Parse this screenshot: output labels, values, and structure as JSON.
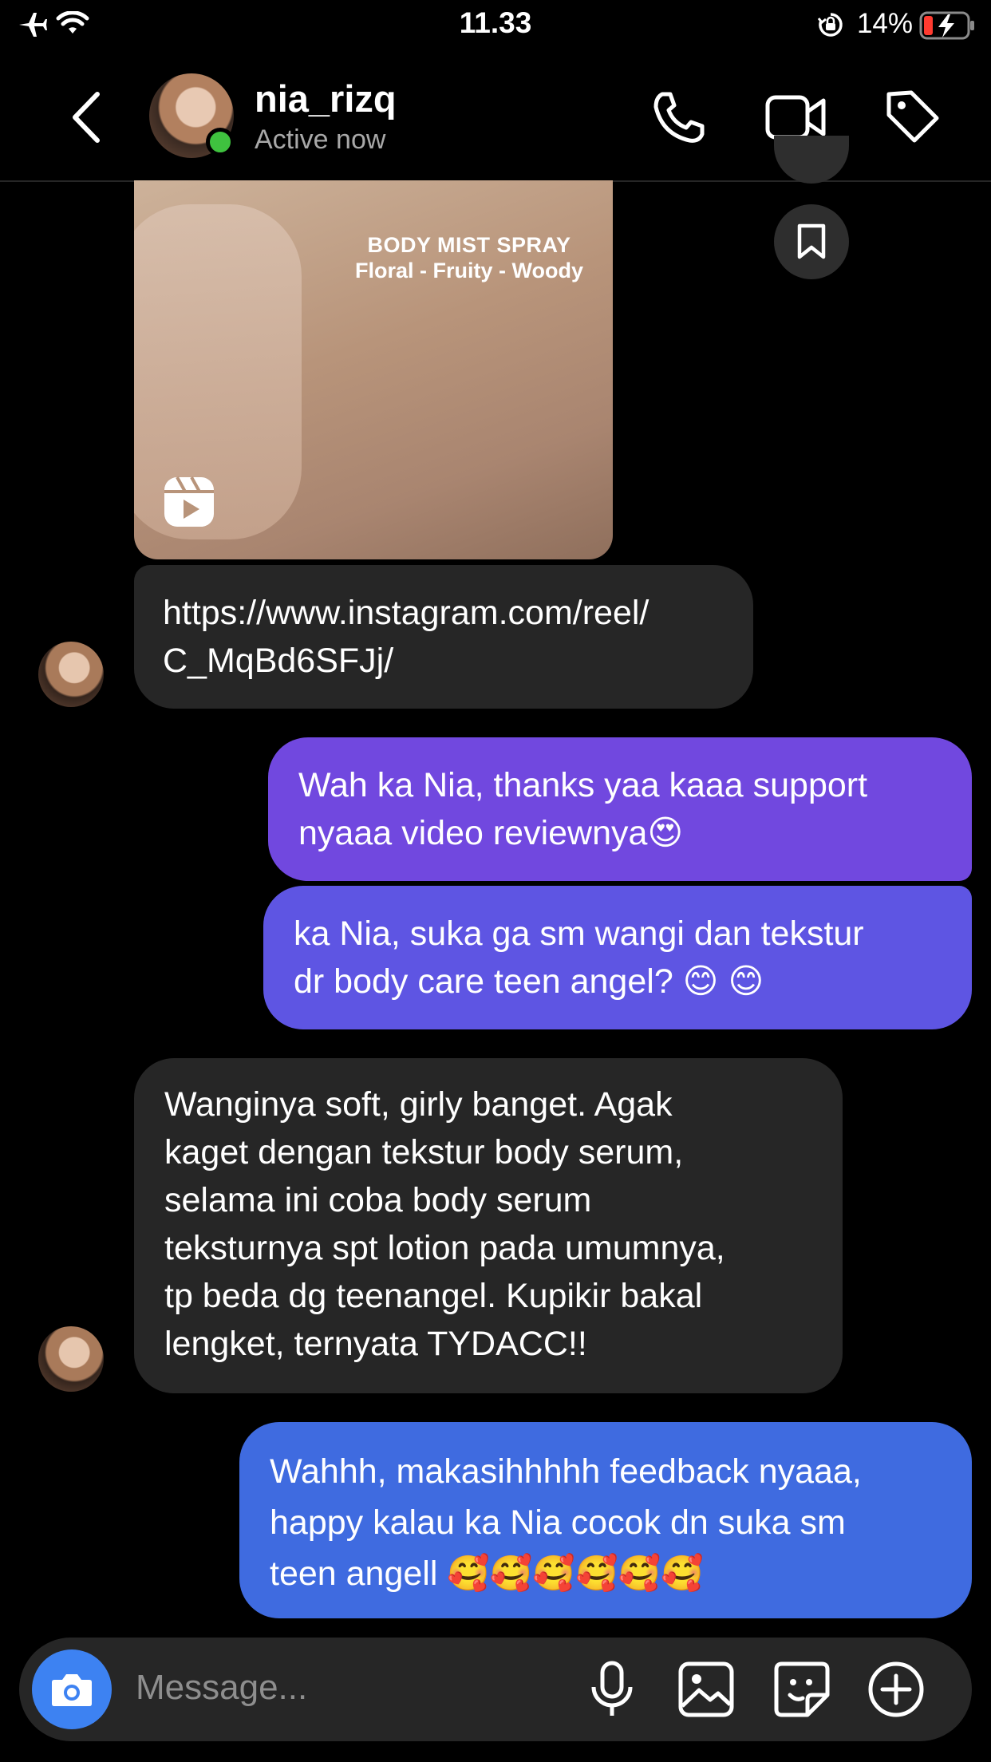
{
  "status_bar": {
    "time": "11.33",
    "battery": "14%",
    "icons": [
      "airplane-icon",
      "wifi-icon",
      "orientation-lock-icon",
      "battery-charging-icon"
    ]
  },
  "header": {
    "username": "nia_rizq",
    "activity": "Active now",
    "icons": [
      "back-icon",
      "phone-icon",
      "video-icon",
      "tag-icon"
    ],
    "online_color": "#3fc23f"
  },
  "shared_reel": {
    "caption_line1": "BODY MIST SPRAY",
    "caption_line2": "Floral - Fruity - Woody",
    "link_line1": "https://www.instagram.com/reel/",
    "link_line2": "C_MqBd6SFJj/"
  },
  "messages": [
    {
      "from": "me",
      "lines": [
        "Wah ka Nia, thanks yaa kaaa support",
        "nyaaa video reviewnya😍"
      ]
    },
    {
      "from": "me",
      "lines": [
        "ka Nia, suka ga sm wangi dan tekstur",
        "dr body care teen angel? 😊 😊"
      ]
    },
    {
      "from": "them",
      "lines": [
        "Wanginya soft, girly banget. Agak",
        "kaget dengan tekstur body serum,",
        "selama ini coba body serum",
        "teksturnya spt lotion pada umumnya,",
        "tp beda dg teenangel. Kupikir bakal",
        "lengket, ternyata TYDACC!!"
      ]
    },
    {
      "from": "me",
      "lines": [
        "Wahhh, makasihhhhh feedback nyaaa,",
        "happy kalau ka Nia cocok dn suka sm",
        "teen angell 🥰🥰🥰🥰🥰🥰"
      ]
    }
  ],
  "composer": {
    "placeholder": "Message...",
    "icons": [
      "camera-icon",
      "microphone-icon",
      "gallery-icon",
      "sticker-icon",
      "plus-icon"
    ]
  },
  "colors": {
    "bubble_incoming": "#262626",
    "bubble_outgoing_top": "#7247e0",
    "bubble_outgoing_bottom": "#3a6fe0",
    "camera_button": "#3d82f2"
  }
}
